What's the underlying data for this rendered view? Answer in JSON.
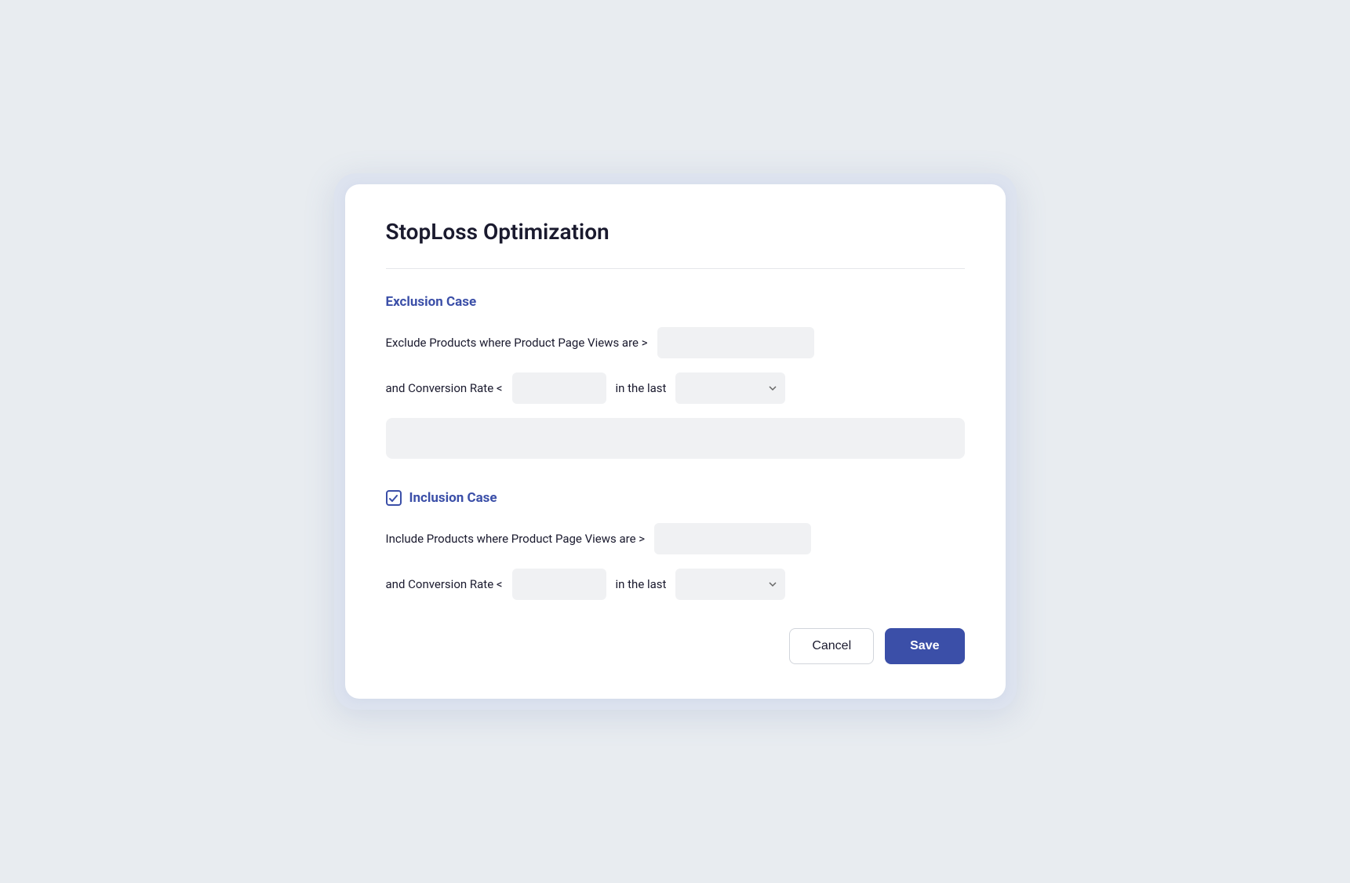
{
  "title": "StopLoss Optimization",
  "exclusion_case": {
    "label": "Exclusion Case",
    "row1_label": "Exclude Products where Product Page Views are >",
    "row1_input_placeholder": "",
    "row2_label": "and Conversion Rate <",
    "row2_input_placeholder": "",
    "row2_in_the_last": "in the last",
    "row2_select_placeholder": "",
    "textarea_placeholder": ""
  },
  "inclusion_case": {
    "label": "Inclusion Case",
    "row1_label": "Include Products where Product Page Views are >",
    "row1_input_placeholder": "",
    "row2_label": "and Conversion Rate <",
    "row2_input_placeholder": "",
    "row2_in_the_last": "in the last",
    "row2_select_placeholder": ""
  },
  "buttons": {
    "cancel": "Cancel",
    "save": "Save"
  }
}
